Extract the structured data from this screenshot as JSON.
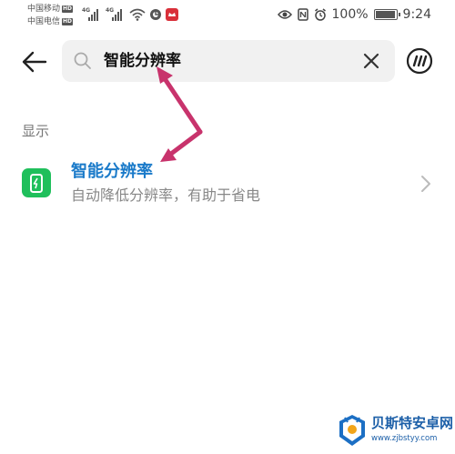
{
  "status_bar": {
    "carrier_1": "中国移动",
    "carrier_2": "中国电信",
    "hd_label": "HD",
    "network_gen": "4G",
    "battery_percent": "100%",
    "battery_level": 1.0,
    "time": "9:24"
  },
  "search": {
    "value": "智能分辨率",
    "icon": "search-icon"
  },
  "section": {
    "header": "显示"
  },
  "results": [
    {
      "title": "智能分辨率",
      "description": "自动降低分辨率，有助于省电",
      "icon": "battery-saver-icon"
    }
  ],
  "watermark": {
    "title": "贝斯特安卓网",
    "url": "www.zjbstyy.com"
  },
  "colors": {
    "accent": "#1a7ac9",
    "icon_green": "#1fbf5b",
    "annotation": "#c8336c",
    "search_bg": "#f1f1f1"
  }
}
